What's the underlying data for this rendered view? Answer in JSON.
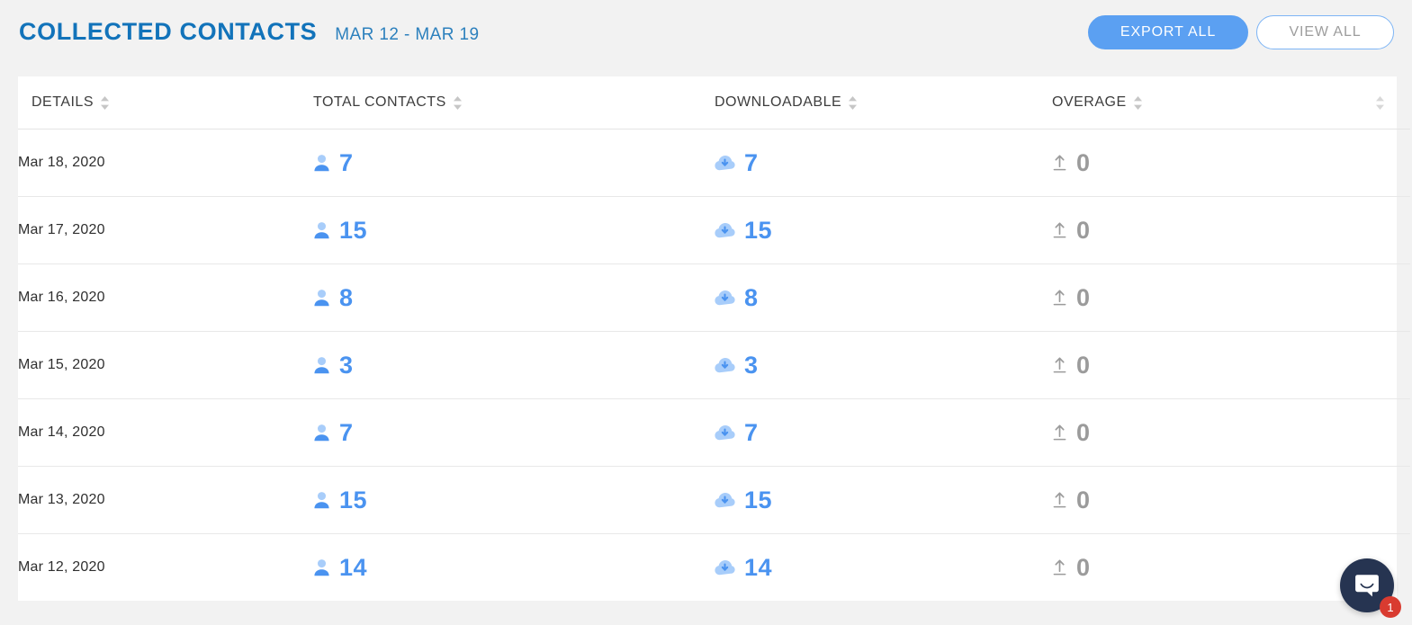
{
  "header": {
    "title": "COLLECTED CONTACTS",
    "date_range": "MAR 12 - MAR 19",
    "export_label": "EXPORT ALL",
    "view_label": "VIEW ALL",
    "title_color": "#1273ba",
    "primary_button_color": "#5ba0f2"
  },
  "table": {
    "columns": [
      {
        "label": "DETAILS",
        "sortable": true
      },
      {
        "label": "TOTAL CONTACTS",
        "sortable": true
      },
      {
        "label": "DOWNLOADABLE",
        "sortable": true
      },
      {
        "label": "OVERAGE",
        "sortable": true
      },
      {
        "label": "",
        "sortable": true
      }
    ],
    "rows": [
      {
        "date": "Mar 18, 2020",
        "total_contacts": "7",
        "downloadable": "7",
        "overage": "0"
      },
      {
        "date": "Mar 17, 2020",
        "total_contacts": "15",
        "downloadable": "15",
        "overage": "0"
      },
      {
        "date": "Mar 16, 2020",
        "total_contacts": "8",
        "downloadable": "8",
        "overage": "0"
      },
      {
        "date": "Mar 15, 2020",
        "total_contacts": "3",
        "downloadable": "3",
        "overage": "0"
      },
      {
        "date": "Mar 14, 2020",
        "total_contacts": "7",
        "downloadable": "7",
        "overage": "0"
      },
      {
        "date": "Mar 13, 2020",
        "total_contacts": "15",
        "downloadable": "15",
        "overage": "0"
      },
      {
        "date": "Mar 12, 2020",
        "total_contacts": "14",
        "downloadable": "14",
        "overage": "0"
      }
    ],
    "icons": {
      "total_contacts": "person-icon",
      "downloadable": "cloud-download-icon",
      "overage": "upload-arrow-icon",
      "sort": "sort-arrows-icon"
    },
    "accent_color": "#4a93f0",
    "muted_color": "#9b9b9b"
  },
  "support_widget": {
    "icon": "intercom-chat-icon",
    "unread_count": "1",
    "badge_color": "#d93b30",
    "launcher_color": "#263451"
  }
}
